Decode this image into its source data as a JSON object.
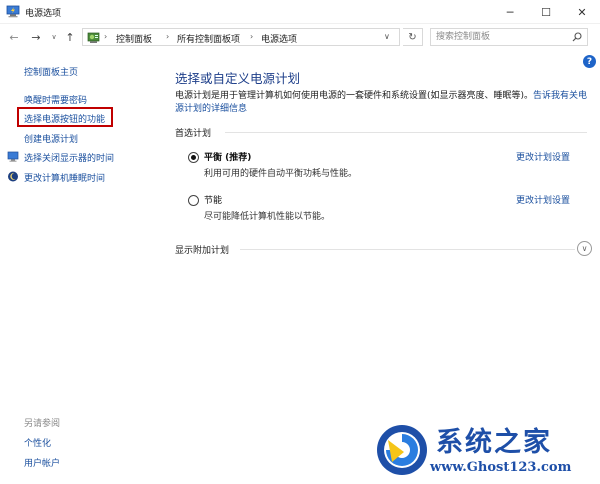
{
  "window": {
    "title": "电源选项",
    "min_glyph": "─",
    "max_glyph": "☐",
    "close_glyph": "✕"
  },
  "nav": {
    "back_glyph": "←",
    "forward_glyph": "→",
    "history_glyph": "∨",
    "up_glyph": "↑",
    "refresh_glyph": "↻",
    "addr_dropdown_glyph": "∨"
  },
  "address": {
    "crumbs": [
      "控制面板",
      "所有控制面板项",
      "电源选项"
    ],
    "separator": "›"
  },
  "search": {
    "placeholder": "搜索控制面板"
  },
  "help": {
    "glyph": "?"
  },
  "sidebar": {
    "items": [
      {
        "label": "控制面板主页"
      },
      {
        "label": "唤醒时需要密码"
      },
      {
        "label": "选择电源按钮的功能"
      },
      {
        "label": "创建电源计划"
      },
      {
        "label": "选择关闭显示器的时间"
      },
      {
        "label": "更改计算机睡眠时间"
      }
    ],
    "see_also": "另请参阅",
    "bottom_items": [
      {
        "label": "个性化"
      },
      {
        "label": "用户帐户"
      }
    ]
  },
  "main": {
    "title": "选择或自定义电源计划",
    "description": "电源计划是用于管理计算机如何使用电源的一套硬件和系统设置(如显示器亮度、睡眠等)。",
    "description_link": "告诉我有关电源计划的详细信息",
    "preferred_header": "首选计划",
    "plans": [
      {
        "name": "平衡 (推荐)",
        "desc": "利用可用的硬件自动平衡功耗与性能。",
        "change_link": "更改计划设置",
        "selected": true
      },
      {
        "name": "节能",
        "desc": "尽可能降低计算机性能以节能。",
        "change_link": "更改计划设置",
        "selected": false
      }
    ],
    "more_plans": "显示附加计划",
    "expand_glyph": "∨"
  },
  "watermark": {
    "brand_cn": "系统之家",
    "url": "www.Ghost123.com"
  },
  "colors": {
    "link": "#1a4f9e",
    "title": "#1e3f8a",
    "highlight_border": "#c00000",
    "watermark": "#1e4fa8"
  }
}
